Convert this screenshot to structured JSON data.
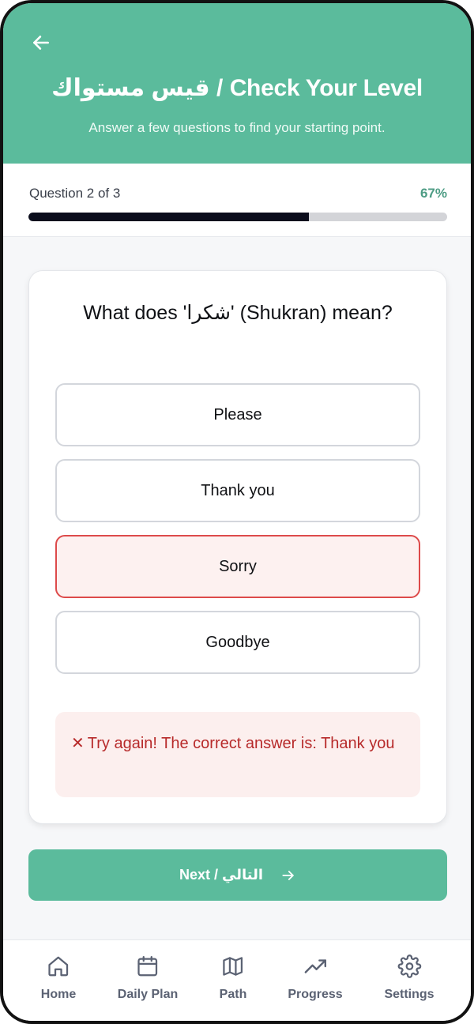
{
  "header": {
    "title": "قيس مستواك / Check Your Level",
    "subtitle": "Answer a few questions to find your starting point."
  },
  "progress": {
    "label": "Question 2 of 3",
    "percent_text": "67%",
    "fraction": 0.67
  },
  "question": {
    "text": "What does 'شكرا' (Shukran) mean?",
    "options": [
      {
        "label": "Please",
        "state": "default"
      },
      {
        "label": "Thank you",
        "state": "default"
      },
      {
        "label": "Sorry",
        "state": "selected-wrong"
      },
      {
        "label": "Goodbye",
        "state": "default"
      }
    ]
  },
  "feedback": {
    "icon": "x-icon",
    "symbol": "✕",
    "text": "Try again! The correct answer is: Thank you"
  },
  "next_button": {
    "label": "Next / التالي"
  },
  "nav": {
    "items": [
      {
        "label": "Home",
        "icon": "home-icon"
      },
      {
        "label": "Daily Plan",
        "icon": "calendar-icon"
      },
      {
        "label": "Path",
        "icon": "map-icon"
      },
      {
        "label": "Progress",
        "icon": "trending-up-icon"
      },
      {
        "label": "Settings",
        "icon": "gear-icon"
      }
    ]
  },
  "colors": {
    "brand": "#5bbb9c",
    "error": "#dd4a4a",
    "progress_fill": "#0b0d1c"
  }
}
